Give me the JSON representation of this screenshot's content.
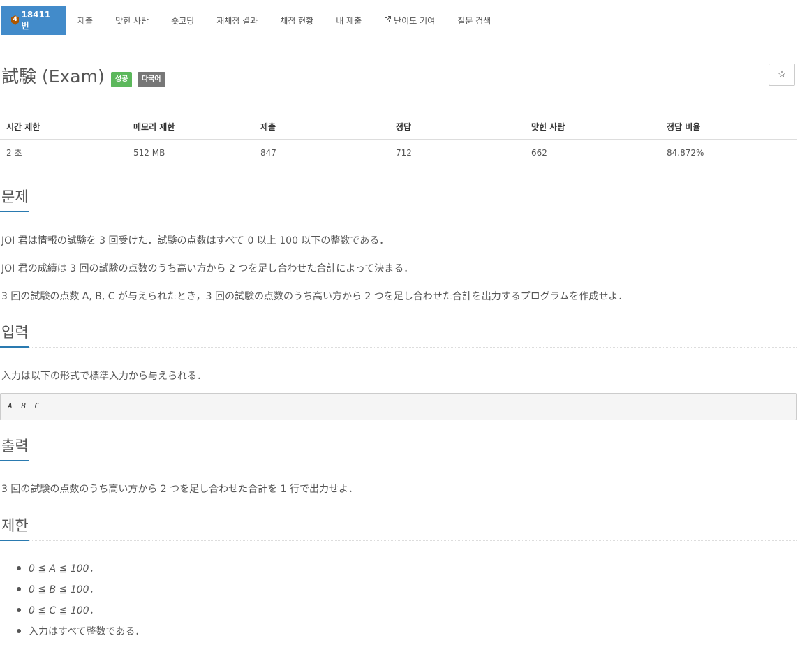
{
  "nav": {
    "problem_tier": "4",
    "problem_id": "18411번",
    "items": [
      {
        "label": "제출"
      },
      {
        "label": "맞힌 사람"
      },
      {
        "label": "숏코딩"
      },
      {
        "label": "재채점 결과"
      },
      {
        "label": "채점 현황"
      },
      {
        "label": "내 제출"
      },
      {
        "label": "난이도 기여",
        "icon": "external-link-icon"
      },
      {
        "label": "질문 검색"
      }
    ]
  },
  "problem": {
    "title": "試験 (Exam)",
    "badges": {
      "status": "성공",
      "lang": "다국어"
    },
    "star": "☆"
  },
  "info": {
    "headers": [
      "시간 제한",
      "메모리 제한",
      "제출",
      "정답",
      "맞힌 사람",
      "정답 비율"
    ],
    "values": [
      "2 초",
      "512 MB",
      "847",
      "712",
      "662",
      "84.872%"
    ]
  },
  "sections": {
    "problem_heading": "문제",
    "problem_p1": "JOI 君は情報の試験を 3 回受けた．試験の点数はすべて 0 以上 100 以下の整数である．",
    "problem_p2": "JOI 君の成績は 3 回の試験の点数のうち高い方から 2 つを足し合わせた合計によって決まる．",
    "problem_p3": "3 回の試験の点数 A, B, C が与えられたとき，3 回の試験の点数のうち高い方から 2 つを足し合わせた合計を出力するプログラムを作成せよ．",
    "input_heading": "입력",
    "input_p": "入力は以下の形式で標準入力から与えられる．",
    "input_format": "A B C",
    "output_heading": "출력",
    "output_p": "3 回の試験の点数のうち高い方から 2 つを足し合わせた合計を 1 行で出力せよ．",
    "limits_heading": "제한",
    "limits": [
      "0 ≦ A ≦ 100．",
      "0 ≦ B ≦ 100．",
      "0 ≦ C ≦ 100．",
      "入力はすべて整数である．"
    ]
  },
  "colors": {
    "nav_active": "#428bca",
    "success_badge": "#5cb85c",
    "lang_badge": "#777777",
    "section_underline": "#2a7ab0"
  }
}
